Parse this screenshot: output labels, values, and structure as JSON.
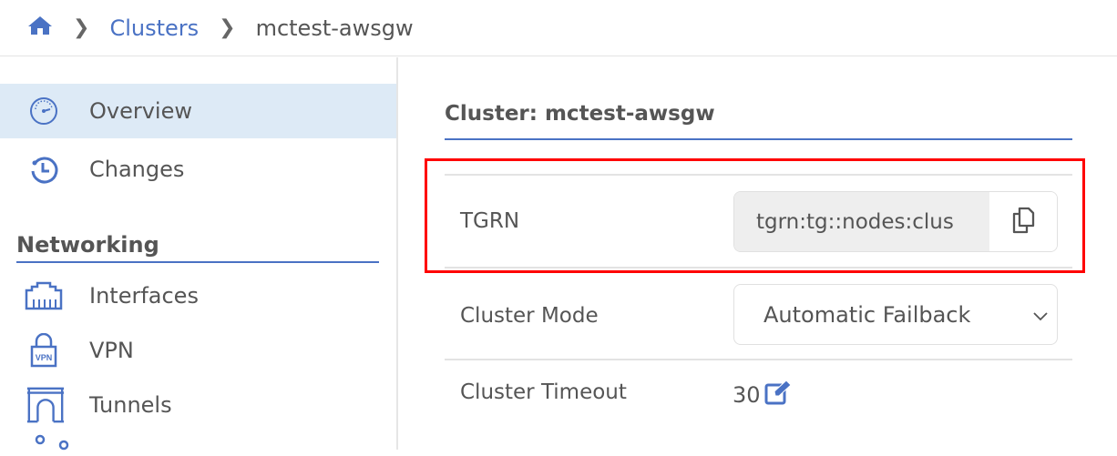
{
  "breadcrumb": {
    "home_icon": "home-icon",
    "items": [
      "Clusters",
      "mctest-awsgw"
    ]
  },
  "sidebar": {
    "items": [
      {
        "label": "Overview",
        "icon": "gauge-icon",
        "active": true
      },
      {
        "label": "Changes",
        "icon": "history-icon"
      }
    ],
    "section": "Networking",
    "networking_items": [
      {
        "label": "Interfaces",
        "icon": "ethernet-port-icon"
      },
      {
        "label": "VPN",
        "icon": "vpn-lock-icon"
      },
      {
        "label": "Tunnels",
        "icon": "tunnel-icon"
      }
    ],
    "vpn_icon_text": "VPN"
  },
  "main": {
    "title": "Cluster: mctest-awsgw",
    "fields": {
      "tgrn": {
        "label": "TGRN",
        "value": "tgrn:tg::nodes:clus"
      },
      "mode": {
        "label": "Cluster Mode",
        "value": "Automatic Failback"
      },
      "timeout": {
        "label": "Cluster Timeout",
        "value": "30"
      }
    }
  },
  "colors": {
    "accent": "#4a72c4",
    "highlight": "#ff0000",
    "active_bg": "#ddeaf6"
  }
}
